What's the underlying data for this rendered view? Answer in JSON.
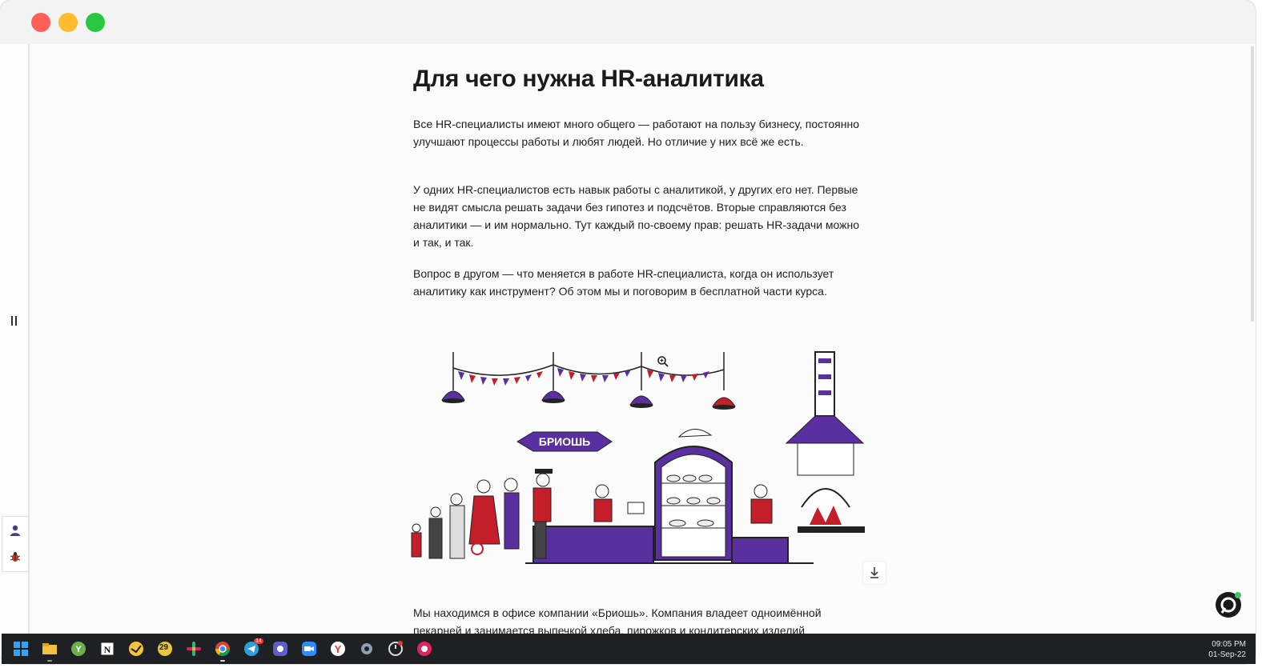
{
  "article": {
    "title": "Для чего нужна HR-аналитика",
    "paragraphs": [
      "Все HR-специалисты имеют много общего — работают на пользу бизнесу, постоянно улучшают процессы работы и любят людей. Но отличие у них всё же есть.",
      "У одних HR-специалистов есть навык работы с аналитикой, у других его нет. Первые не видят смысла решать задачи без гипотез и подсчётов. Вторые справляются без аналитики — и им нормально. Тут каждый по-своему прав: решать HR-задачи можно и так, и так.",
      "Вопрос в другом — что меняется в работе HR-специалиста, когда он использует аналитику как инструмент? Об этом мы и поговорим в бесплатной части курса.",
      "Мы находимся в офисе компании «Бриошь». Компания владеет одноимённой пекарней и занимается выпечкой хлеба, пирожков и кондитерских изделий"
    ],
    "illustration_sign": "БРИОШЬ"
  },
  "taskbar": {
    "calendar_badge": "29",
    "telegram_badge": "14",
    "time": "09:05 PM",
    "date": "01-Sep-22"
  },
  "icons": {
    "start": "windows-start-icon",
    "explorer": "folder-icon",
    "notion": "notion-icon",
    "slack": "slack-icon",
    "chrome": "chrome-icon",
    "telegram": "telegram-icon",
    "zoom": "zoom-icon",
    "yandex": "yandex-browser-icon",
    "settings": "gear-icon"
  },
  "colors": {
    "accent_purple": "#5a2fa0",
    "accent_red": "#c41e2a",
    "taskbar_bg": "#1f2024"
  }
}
